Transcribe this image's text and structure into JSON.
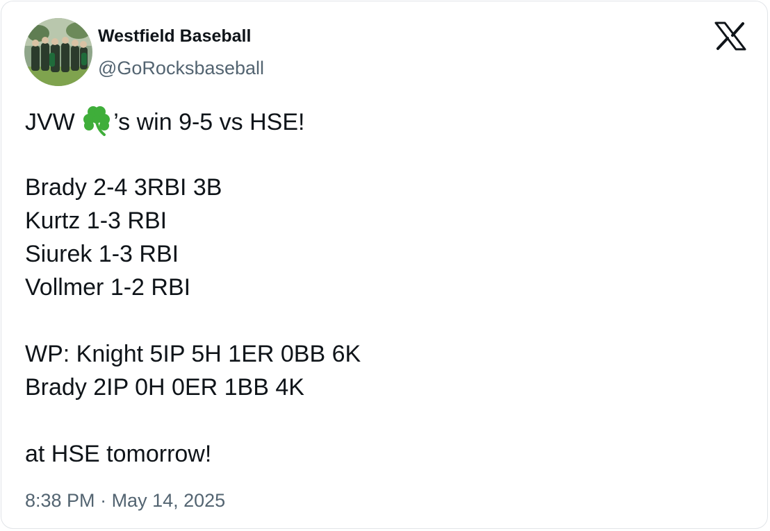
{
  "author": {
    "display_name": "Westfield Baseball",
    "handle": "@GoRocksbaseball",
    "avatar_icon": "team-photo-avatar"
  },
  "brand": {
    "logo_icon": "x-logo-icon",
    "color": "#0f1419"
  },
  "tweet": {
    "headline_before": "JVW ",
    "headline_emoji": "shamrock-icon",
    "headline_after": "’s win 9-5 vs HSE!",
    "batting": [
      "Brady 2-4 3RBI 3B",
      "Kurtz 1-3 RBI",
      "Siurek 1-3 RBI",
      "Vollmer 1-2 RBI"
    ],
    "pitching": [
      "WP: Knight 5IP 5H 1ER 0BB 6K",
      "Brady 2IP 0H 0ER 1BB 4K"
    ],
    "closing": "at HSE tomorrow!"
  },
  "meta": {
    "time": "8:38 PM",
    "separator": " · ",
    "date": "May 14, 2025"
  },
  "colors": {
    "text": "#0f1419",
    "secondary": "#536471",
    "border": "#e1e4e8",
    "shamrock": "#3fae3a"
  }
}
